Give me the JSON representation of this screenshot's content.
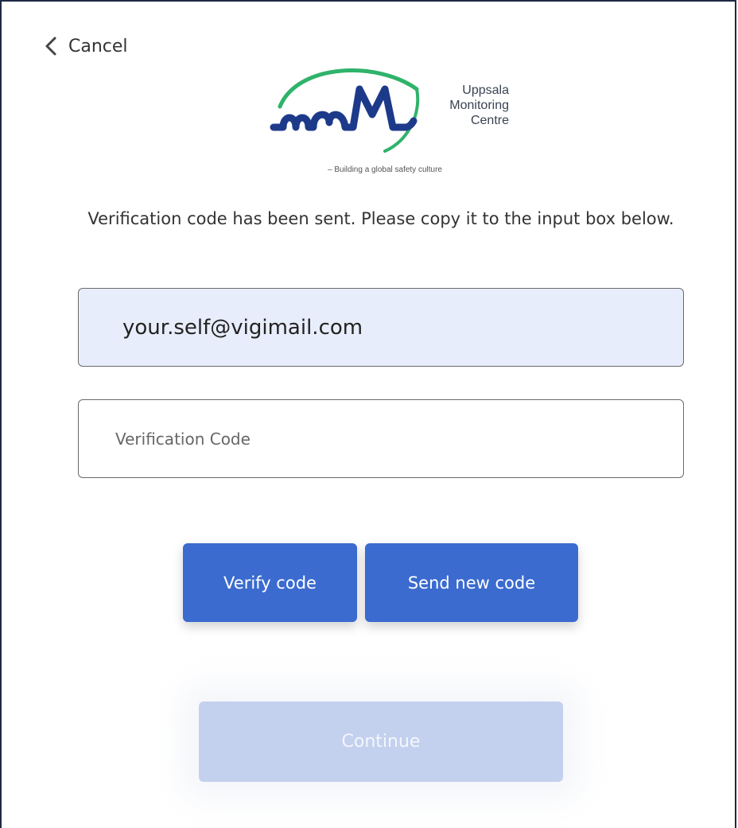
{
  "nav": {
    "cancel_label": "Cancel"
  },
  "logo": {
    "name_line1": "Uppsala",
    "name_line2": "Monitoring",
    "name_line3": "Centre",
    "tagline": "– Building a global safety culture"
  },
  "message": "Verification code has been sent. Please copy it to the input box below.",
  "email_field": {
    "value": "your.self@vigimail.com"
  },
  "code_field": {
    "placeholder": "Verification Code",
    "value": ""
  },
  "buttons": {
    "verify_label": "Verify code",
    "send_new_label": "Send new code",
    "continue_label": "Continue"
  },
  "colors": {
    "primary": "#3b6bcf",
    "disabled": "#c3d1ee",
    "email_bg": "#e8edfb",
    "logo_green": "#2fb36b",
    "logo_navy": "#1d3a8a"
  }
}
